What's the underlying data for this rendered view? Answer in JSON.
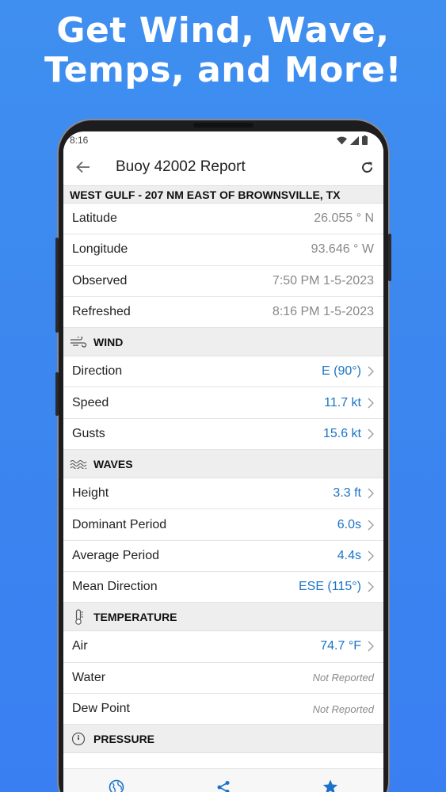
{
  "headline": {
    "line1": "Get Wind, Wave,",
    "line2": "Temps, and More!"
  },
  "status_bar": {
    "time": "8:16"
  },
  "app_bar": {
    "title": "Buoy 42002 Report"
  },
  "location": "WEST GULF - 207 NM EAST OF BROWNSVILLE, TX",
  "info_rows": [
    {
      "label": "Latitude",
      "value": "26.055 ° N"
    },
    {
      "label": "Longitude",
      "value": "93.646 ° W"
    },
    {
      "label": "Observed",
      "value": "7:50 PM 1-5-2023"
    },
    {
      "label": "Refreshed",
      "value": "8:16 PM 1-5-2023"
    }
  ],
  "wind": {
    "title": "WIND",
    "rows": [
      {
        "label": "Direction",
        "value": "E (90°)"
      },
      {
        "label": "Speed",
        "value": "11.7 kt"
      },
      {
        "label": "Gusts",
        "value": "15.6 kt"
      }
    ]
  },
  "waves": {
    "title": "WAVES",
    "rows": [
      {
        "label": "Height",
        "value": "3.3 ft"
      },
      {
        "label": "Dominant Period",
        "value": "6.0s"
      },
      {
        "label": "Average Period",
        "value": "4.4s"
      },
      {
        "label": "Mean Direction",
        "value": "ESE (115°)"
      }
    ]
  },
  "temperature": {
    "title": "TEMPERATURE",
    "rows": [
      {
        "label": "Air",
        "value": "74.7 °F"
      },
      {
        "label": "Water",
        "value": "Not Reported"
      },
      {
        "label": "Dew Point",
        "value": "Not Reported"
      }
    ]
  },
  "pressure": {
    "title": "PRESSURE"
  },
  "colors": {
    "accent": "#1a73c8",
    "background": "#3b86ef"
  },
  "icons": {
    "back": "arrow-left-icon",
    "refresh": "refresh-icon",
    "wind": "wind-icon",
    "waves": "waves-icon",
    "temperature": "thermometer-icon",
    "pressure": "gauge-icon",
    "tab1": "globe-icon",
    "tab2": "share-icon",
    "tab3": "star-icon"
  }
}
